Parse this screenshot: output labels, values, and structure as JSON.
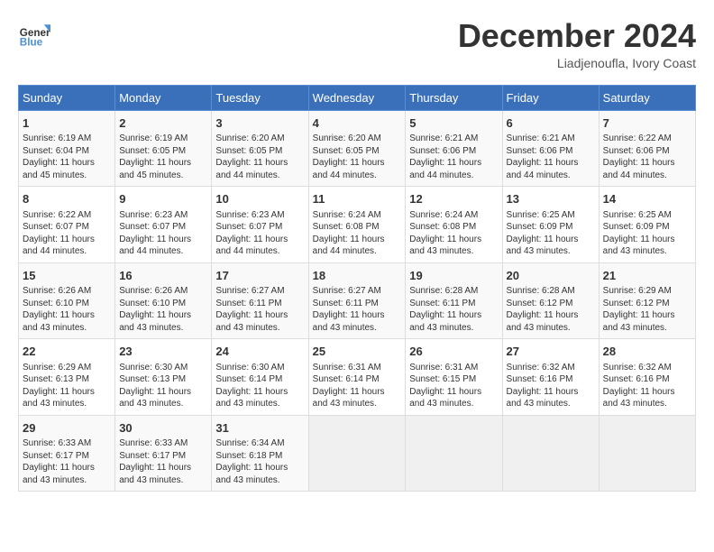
{
  "logo": {
    "line1": "General",
    "line2": "Blue"
  },
  "title": "December 2024",
  "location": "Liadjenoufla, Ivory Coast",
  "days_header": [
    "Sunday",
    "Monday",
    "Tuesday",
    "Wednesday",
    "Thursday",
    "Friday",
    "Saturday"
  ],
  "weeks": [
    [
      {
        "day": "1",
        "info": "Sunrise: 6:19 AM\nSunset: 6:04 PM\nDaylight: 11 hours\nand 45 minutes."
      },
      {
        "day": "2",
        "info": "Sunrise: 6:19 AM\nSunset: 6:05 PM\nDaylight: 11 hours\nand 45 minutes."
      },
      {
        "day": "3",
        "info": "Sunrise: 6:20 AM\nSunset: 6:05 PM\nDaylight: 11 hours\nand 44 minutes."
      },
      {
        "day": "4",
        "info": "Sunrise: 6:20 AM\nSunset: 6:05 PM\nDaylight: 11 hours\nand 44 minutes."
      },
      {
        "day": "5",
        "info": "Sunrise: 6:21 AM\nSunset: 6:06 PM\nDaylight: 11 hours\nand 44 minutes."
      },
      {
        "day": "6",
        "info": "Sunrise: 6:21 AM\nSunset: 6:06 PM\nDaylight: 11 hours\nand 44 minutes."
      },
      {
        "day": "7",
        "info": "Sunrise: 6:22 AM\nSunset: 6:06 PM\nDaylight: 11 hours\nand 44 minutes."
      }
    ],
    [
      {
        "day": "8",
        "info": "Sunrise: 6:22 AM\nSunset: 6:07 PM\nDaylight: 11 hours\nand 44 minutes."
      },
      {
        "day": "9",
        "info": "Sunrise: 6:23 AM\nSunset: 6:07 PM\nDaylight: 11 hours\nand 44 minutes."
      },
      {
        "day": "10",
        "info": "Sunrise: 6:23 AM\nSunset: 6:07 PM\nDaylight: 11 hours\nand 44 minutes."
      },
      {
        "day": "11",
        "info": "Sunrise: 6:24 AM\nSunset: 6:08 PM\nDaylight: 11 hours\nand 44 minutes."
      },
      {
        "day": "12",
        "info": "Sunrise: 6:24 AM\nSunset: 6:08 PM\nDaylight: 11 hours\nand 43 minutes."
      },
      {
        "day": "13",
        "info": "Sunrise: 6:25 AM\nSunset: 6:09 PM\nDaylight: 11 hours\nand 43 minutes."
      },
      {
        "day": "14",
        "info": "Sunrise: 6:25 AM\nSunset: 6:09 PM\nDaylight: 11 hours\nand 43 minutes."
      }
    ],
    [
      {
        "day": "15",
        "info": "Sunrise: 6:26 AM\nSunset: 6:10 PM\nDaylight: 11 hours\nand 43 minutes."
      },
      {
        "day": "16",
        "info": "Sunrise: 6:26 AM\nSunset: 6:10 PM\nDaylight: 11 hours\nand 43 minutes."
      },
      {
        "day": "17",
        "info": "Sunrise: 6:27 AM\nSunset: 6:11 PM\nDaylight: 11 hours\nand 43 minutes."
      },
      {
        "day": "18",
        "info": "Sunrise: 6:27 AM\nSunset: 6:11 PM\nDaylight: 11 hours\nand 43 minutes."
      },
      {
        "day": "19",
        "info": "Sunrise: 6:28 AM\nSunset: 6:11 PM\nDaylight: 11 hours\nand 43 minutes."
      },
      {
        "day": "20",
        "info": "Sunrise: 6:28 AM\nSunset: 6:12 PM\nDaylight: 11 hours\nand 43 minutes."
      },
      {
        "day": "21",
        "info": "Sunrise: 6:29 AM\nSunset: 6:12 PM\nDaylight: 11 hours\nand 43 minutes."
      }
    ],
    [
      {
        "day": "22",
        "info": "Sunrise: 6:29 AM\nSunset: 6:13 PM\nDaylight: 11 hours\nand 43 minutes."
      },
      {
        "day": "23",
        "info": "Sunrise: 6:30 AM\nSunset: 6:13 PM\nDaylight: 11 hours\nand 43 minutes."
      },
      {
        "day": "24",
        "info": "Sunrise: 6:30 AM\nSunset: 6:14 PM\nDaylight: 11 hours\nand 43 minutes."
      },
      {
        "day": "25",
        "info": "Sunrise: 6:31 AM\nSunset: 6:14 PM\nDaylight: 11 hours\nand 43 minutes."
      },
      {
        "day": "26",
        "info": "Sunrise: 6:31 AM\nSunset: 6:15 PM\nDaylight: 11 hours\nand 43 minutes."
      },
      {
        "day": "27",
        "info": "Sunrise: 6:32 AM\nSunset: 6:16 PM\nDaylight: 11 hours\nand 43 minutes."
      },
      {
        "day": "28",
        "info": "Sunrise: 6:32 AM\nSunset: 6:16 PM\nDaylight: 11 hours\nand 43 minutes."
      }
    ],
    [
      {
        "day": "29",
        "info": "Sunrise: 6:33 AM\nSunset: 6:17 PM\nDaylight: 11 hours\nand 43 minutes."
      },
      {
        "day": "30",
        "info": "Sunrise: 6:33 AM\nSunset: 6:17 PM\nDaylight: 11 hours\nand 43 minutes."
      },
      {
        "day": "31",
        "info": "Sunrise: 6:34 AM\nSunset: 6:18 PM\nDaylight: 11 hours\nand 43 minutes."
      },
      null,
      null,
      null,
      null
    ]
  ]
}
